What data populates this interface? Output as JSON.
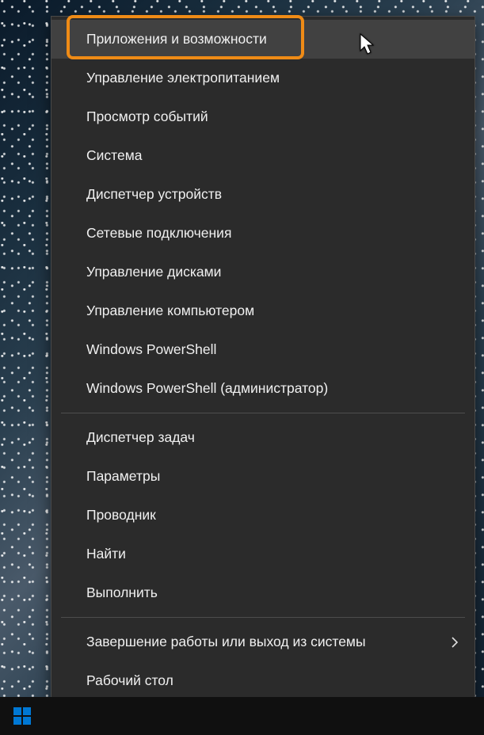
{
  "menu": {
    "groups": [
      [
        {
          "id": "apps-and-features",
          "label": "Приложения и возможности",
          "highlighted": true
        },
        {
          "id": "power-options",
          "label": "Управление электропитанием"
        },
        {
          "id": "event-viewer",
          "label": "Просмотр событий"
        },
        {
          "id": "system",
          "label": "Система"
        },
        {
          "id": "device-manager",
          "label": "Диспетчер устройств"
        },
        {
          "id": "network-connections",
          "label": "Сетевые подключения"
        },
        {
          "id": "disk-management",
          "label": "Управление дисками"
        },
        {
          "id": "computer-management",
          "label": "Управление компьютером"
        },
        {
          "id": "powershell",
          "label": "Windows PowerShell"
        },
        {
          "id": "powershell-admin",
          "label": "Windows PowerShell (администратор)"
        }
      ],
      [
        {
          "id": "task-manager",
          "label": "Диспетчер задач"
        },
        {
          "id": "settings",
          "label": "Параметры"
        },
        {
          "id": "file-explorer",
          "label": "Проводник"
        },
        {
          "id": "search",
          "label": "Найти"
        },
        {
          "id": "run",
          "label": "Выполнить"
        }
      ],
      [
        {
          "id": "shutdown-signout",
          "label": "Завершение работы или выход из системы",
          "submenu": true
        },
        {
          "id": "desktop",
          "label": "Рабочий стол"
        }
      ]
    ]
  },
  "highlight": {
    "target": "apps-and-features",
    "color": "#ef8b16"
  }
}
